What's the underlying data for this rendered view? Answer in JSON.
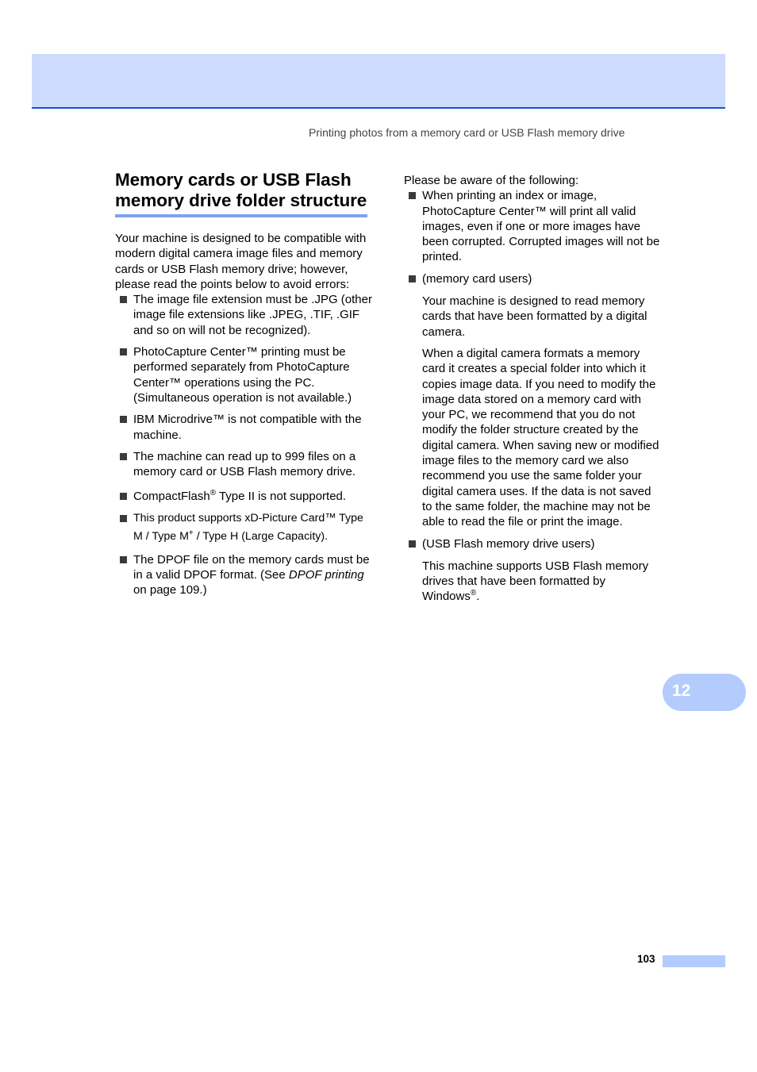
{
  "header": {
    "running_head": "Printing photos from a memory card or USB Flash memory drive",
    "band_color": "#cddcfc",
    "rule_color": "#1a4fd6"
  },
  "left_column": {
    "title": "Memory cards or USB Flash memory drive folder structure",
    "intro": "Your machine is designed to be compatible with modern digital camera image files and memory cards or USB Flash memory drive; however, please read the points below to avoid errors:",
    "bullets": [
      {
        "text": "The image file extension must be .JPG (other image file extensions like .JPEG, .TIF, .GIF and so on will not be recognized)."
      },
      {
        "text": "PhotoCapture Center™ printing must be performed separately from PhotoCapture Center™ operations using the PC. (Simultaneous operation is not available.)"
      },
      {
        "text": "IBM Microdrive™ is not compatible with the machine."
      },
      {
        "text": "The machine can read up to 999 files on a memory card or USB Flash memory drive."
      },
      {
        "pre": "CompactFlash",
        "sup": "®",
        "post": " Type II is not supported."
      },
      {
        "pre": "This product supports xD-Picture Card™ Type M / Type M",
        "sup": "+",
        "post": " / Type H (Large Capacity)."
      },
      {
        "pre": "The DPOF file on the memory cards must be in a valid DPOF format. (See ",
        "italic": "DPOF printing",
        "post": " on page 109.)"
      }
    ]
  },
  "right_column": {
    "intro": "Please be aware of the following:",
    "bullets": [
      {
        "text": "When printing an index or image, PhotoCapture Center™ will print all valid images, even if one or more images have been corrupted. Corrupted images will not be printed."
      },
      {
        "text": "(memory card users)",
        "paragraphs": [
          "Your machine is designed to read memory cards that have been formatted by a digital camera.",
          "When a digital camera formats a memory card it creates a special folder into which it copies image data. If you need to modify the image data stored on a memory card with your PC, we recommend that you do not modify the folder structure created by the digital camera. When saving new or modified image files to the memory card we also recommend you use the same folder your digital camera uses. If the data is not saved to the same folder, the machine may not be able to read the file or print the image."
        ]
      },
      {
        "text": "(USB Flash memory drive users)",
        "para_pre": "This machine supports USB Flash memory drives that have been formatted by Windows",
        "para_sup": "®",
        "para_post": "."
      }
    ]
  },
  "chapter_tab": {
    "number": "12",
    "color": "#b3cbfd"
  },
  "footer": {
    "page_number": "103"
  }
}
